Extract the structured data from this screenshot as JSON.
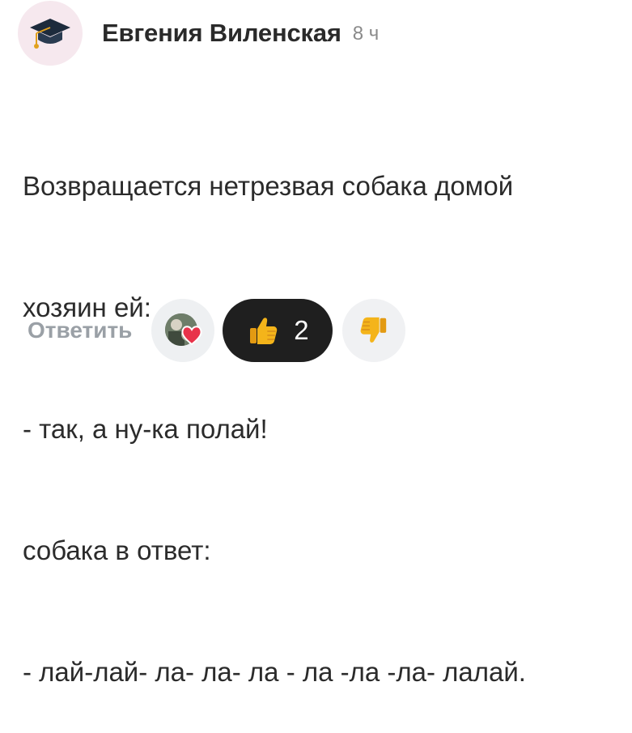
{
  "author": {
    "name": "Евгения Виленская",
    "time": "8 ч",
    "avatar_icon": "graduation-cap-icon"
  },
  "post": {
    "lines": [
      "Возвращается нетрезвая собака домой",
      "хозяин ей:",
      "- так, а ну-ка полай!",
      "собака в ответ:",
      "- лай-лай- ла- ла- ла - ла -ла -ла- лалай."
    ]
  },
  "actions": {
    "reply_label": "Ответить",
    "reactors_icon": "reactor-avatars-icon",
    "like": {
      "icon": "thumbs-up-icon",
      "count": "2",
      "active": true
    },
    "dislike": {
      "icon": "thumbs-down-icon"
    }
  },
  "colors": {
    "accent_dark": "#1f1f1f",
    "like_yellow": "#f4b41a",
    "heart_red": "#e8334a",
    "muted": "#9aa0a6"
  }
}
